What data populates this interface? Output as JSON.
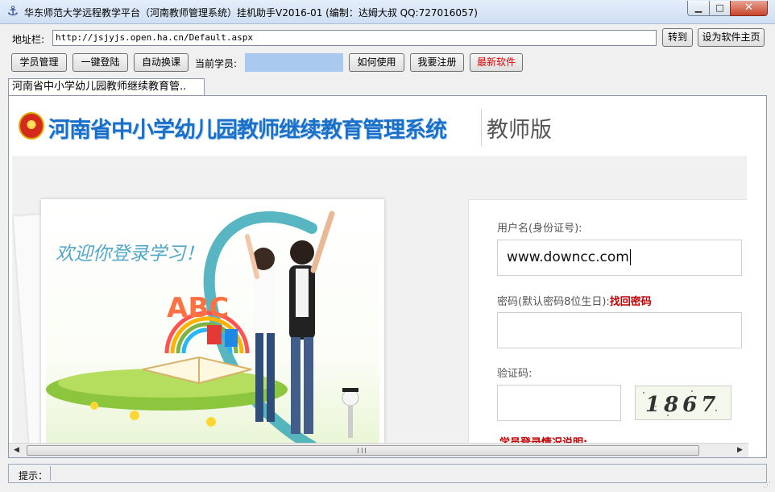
{
  "window": {
    "title": "华东师范大学远程教学平台（河南教师管理系统）挂机助手V2016-01 (编制：达姆大叔 QQ:727016057)",
    "min_glyph": "▁",
    "max_glyph": "□",
    "close_glyph": "✕",
    "icon_glyph": "⚓"
  },
  "address": {
    "label": "地址栏:",
    "url": "http://jsjyjs.open.ha.cn/Default.aspx",
    "go_label": "转到",
    "home_label": "设为软件主页"
  },
  "toolbar": {
    "student_mgmt": "学员管理",
    "one_click_login": "一键登陆",
    "auto_switch": "自动换课",
    "current_label": "当前学员:",
    "current_value": "",
    "how_to_use": "如何使用",
    "register": "我要注册",
    "latest": "最新软件"
  },
  "tab": {
    "label": "河南省中小学幼儿园教师继续教育管.."
  },
  "site": {
    "title": "河南省中小学幼儿园教师继续教育管理系统",
    "edition": "教师版",
    "welcome": "欢迎你登录学习！"
  },
  "login": {
    "username_label": "用户名(身份证号):",
    "username_value": "www.downcc.com",
    "password_label": "密码(默认密码8位生日):",
    "forgot_link": "找回密码",
    "captcha_label": "验证码:",
    "captcha_text": "1867",
    "notes_heading": "学员登录情况说明:"
  },
  "status": {
    "label": "提示："
  },
  "colors": {
    "title_blue": "#1a6fc9",
    "alert_red": "#c00000",
    "current_student_bg": "#a9c9ee"
  }
}
